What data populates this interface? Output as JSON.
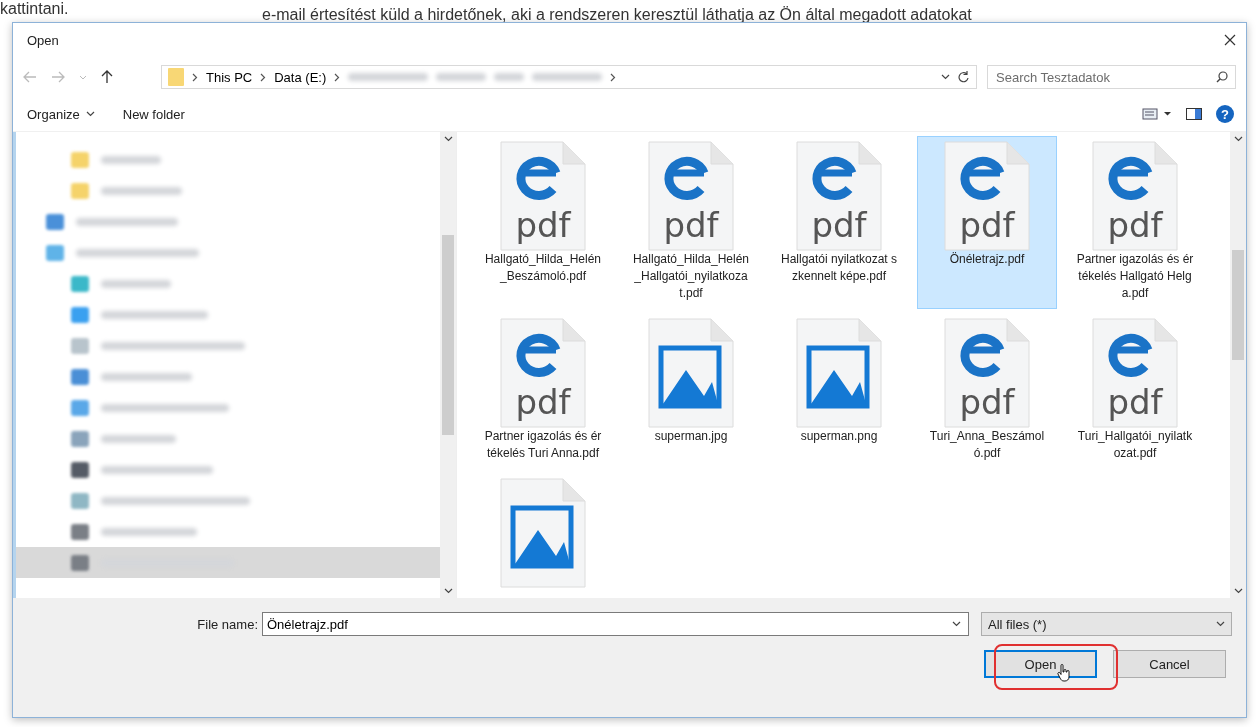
{
  "page_behind": {
    "lines": [
      "kattintani.",
      "e-mail értesítést küld a hirdetőnek, aki a rendszeren keresztül láthatja az Ön által megadott adatokat"
    ]
  },
  "window": {
    "title": "Open"
  },
  "address_bar": {
    "crumbs": [
      "This PC",
      "Data (E:)"
    ],
    "search_placeholder": "Search Tesztadatok"
  },
  "toolbar": {
    "organize": "Organize",
    "new_folder": "New folder",
    "help": "?"
  },
  "sidebar": {
    "items": [
      {
        "kind": "pinned",
        "color": "#f5d36a",
        "selected": false
      },
      {
        "kind": "pinned",
        "color": "#f5d36a",
        "selected": false
      },
      {
        "kind": "root",
        "color": "#4a90d9",
        "selected": false
      },
      {
        "kind": "root",
        "color": "#5fb3e8",
        "selected": false,
        "children": [
          {
            "color": "#3bb8c9",
            "selected": false
          },
          {
            "color": "#3aa0f0",
            "selected": false
          },
          {
            "color": "#b8c4cc",
            "selected": false
          },
          {
            "color": "#4a8fd6",
            "selected": false
          },
          {
            "color": "#5aa8e8",
            "selected": false
          },
          {
            "color": "#8aa4bb",
            "selected": false
          },
          {
            "color": "#555b66",
            "selected": false
          },
          {
            "color": "#8fb7c4",
            "selected": false
          },
          {
            "color": "#7a7f86",
            "selected": false
          },
          {
            "color": "#7a7f86",
            "selected": true
          }
        ]
      }
    ]
  },
  "files": [
    {
      "kind": "pdf",
      "icon_text": "pdf",
      "name": "Hallgató_Hilda_Helén_Beszámoló.pdf",
      "selected": false
    },
    {
      "kind": "pdf",
      "icon_text": "pdf",
      "name": "Hallgató_Hilda_Helén_Hallgatói_nyilatkozat.pdf",
      "selected": false
    },
    {
      "kind": "pdf",
      "icon_text": "pdf",
      "name": "Hallgatói nyilatkozat szkennelt képe.pdf",
      "selected": false
    },
    {
      "kind": "pdf",
      "icon_text": "pdf",
      "name": "Önéletrajz.pdf",
      "selected": true
    },
    {
      "kind": "pdf",
      "icon_text": "pdf",
      "name": "Partner igazolás és értékelés Hallgató Helga.pdf",
      "selected": false
    },
    {
      "kind": "pdf",
      "icon_text": "pdf",
      "name": "Partner igazolás és értékelés Turi Anna.pdf",
      "selected": false
    },
    {
      "kind": "image",
      "name": "superman.jpg",
      "selected": false
    },
    {
      "kind": "image",
      "name": "superman.png",
      "selected": false
    },
    {
      "kind": "pdf",
      "icon_text": "pdf",
      "name": "Turi_Anna_Beszámoló.pdf",
      "selected": false
    },
    {
      "kind": "pdf",
      "icon_text": "pdf",
      "name": "Turi_Hallgatói_nyilatkozat.pdf",
      "selected": false
    },
    {
      "kind": "image",
      "selected": false
    }
  ],
  "footer": {
    "file_name_label": "File name:",
    "file_name_value": "Önéletrajz.pdf",
    "file_type": "All files (*)",
    "open": "Open",
    "cancel": "Cancel"
  }
}
